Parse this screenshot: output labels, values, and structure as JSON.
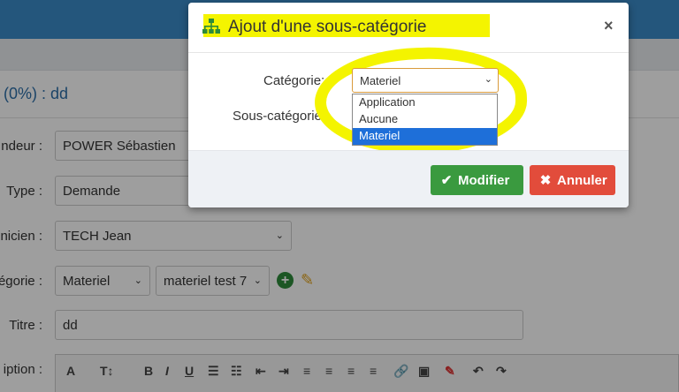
{
  "background": {
    "heading": "(0%) : dd",
    "fields": [
      {
        "label": "ndeur :",
        "value": "POWER Sébastien"
      },
      {
        "label": "Type :",
        "value": "Demande"
      },
      {
        "label": "nicien :",
        "value": "TECH Jean"
      },
      {
        "label": "égorie :",
        "value": "Materiel",
        "value2": "materiel test 7"
      },
      {
        "label": "Titre :",
        "value": "dd"
      },
      {
        "label": "iption :",
        "value": ""
      }
    ],
    "toolbar": [
      "A",
      "T↕",
      "B",
      "I",
      "U",
      "☰",
      "☷",
      "⇤",
      "⇥",
      "≡",
      "≡",
      "≡",
      "≡",
      "🔗",
      "▣",
      "✎",
      "↶",
      "↷"
    ]
  },
  "modal": {
    "title": "Ajout d'une sous-catégorie",
    "close_symbol": "×",
    "category_label": "Catégorie:",
    "subcategory_label": "Sous-catégorie:",
    "category_selected": "Materiel",
    "category_options": [
      "Application",
      "Aucune",
      "Materiel"
    ],
    "ok_label": "Modifier",
    "cancel_label": "Annuler"
  },
  "colors": {
    "highlight": "#f4f400",
    "ok": "#3a9a3f",
    "cancel": "#e24c3b",
    "selected_option": "#1e6fd9"
  },
  "icons": {
    "title_icon": "sitemap-icon",
    "ok_icon": "check-icon",
    "cancel_icon": "times-icon"
  }
}
